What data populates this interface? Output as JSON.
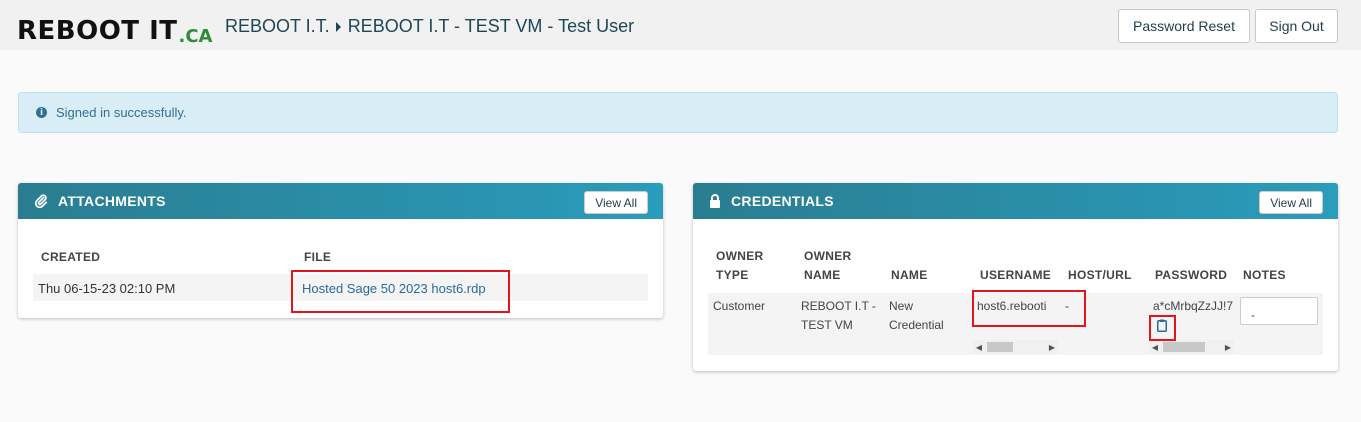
{
  "header": {
    "logo_main": "REBOOT IT",
    "logo_suffix": ".CA",
    "breadcrumb": [
      "REBOOT I.T.",
      "REBOOT I.T - TEST VM - Test User"
    ],
    "password_reset_label": "Password Reset",
    "sign_out_label": "Sign Out"
  },
  "alert": {
    "message": "Signed in successfully.",
    "icon": "info-circle-icon"
  },
  "attachments": {
    "title": "ATTACHMENTS",
    "icon": "paperclip-icon",
    "view_all_label": "View All",
    "columns": [
      "CREATED",
      "FILE"
    ],
    "rows": [
      {
        "created": "Thu 06-15-23 02:10 PM",
        "file": "Hosted Sage 50 2023 host6.rdp"
      }
    ]
  },
  "credentials": {
    "title": "CREDENTIALS",
    "icon": "lock-icon",
    "view_all_label": "View All",
    "columns": {
      "owner_type": [
        "OWNER",
        "TYPE"
      ],
      "owner_name": [
        "OWNER",
        "NAME"
      ],
      "name": "NAME",
      "username": "USERNAME",
      "host_url": "HOST/URL",
      "password": "PASSWORD",
      "notes": "NOTES"
    },
    "row": {
      "owner_type": "Customer",
      "owner_name": [
        "REBOOT I.T -",
        "TEST VM"
      ],
      "name": [
        "New",
        "Credential"
      ],
      "username": "host6.rebooti",
      "host_url": "-",
      "password": "a*cMrbqZzJJ!7",
      "notes": "-"
    }
  },
  "colors": {
    "accent_start": "#2a7d90",
    "accent_end": "#2a9cbc",
    "highlight": "#e4141b",
    "logo_green": "#2e8b3a"
  }
}
